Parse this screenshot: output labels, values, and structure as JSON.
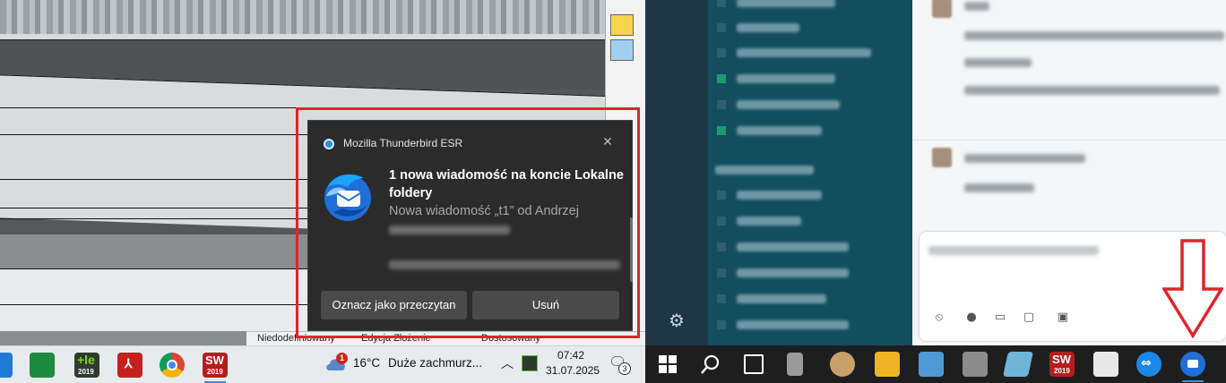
{
  "cad": {
    "status": [
      "Niedodefiniowany",
      "Edycja Złożenie",
      "Dostosowany"
    ]
  },
  "notification": {
    "app_name": "Mozilla Thunderbird ESR",
    "title": "1 nowa wiadomość na koncie Lokalne foldery",
    "body": "Nowa wiadomość „t1” od Andrzej",
    "mark_read_label": "Oznacz jako przeczytan",
    "delete_label": "Usuń",
    "close_icon": "close-icon",
    "highlight_color": "#e0242b"
  },
  "taskbar": {
    "weather": {
      "badge": "1",
      "temperature": "16°C",
      "description": "Duże zachmurz..."
    },
    "clock": {
      "time": "07:42",
      "date": "31.07.2025"
    },
    "notification_count": "3",
    "app_labels": {
      "ie_year": "2019",
      "sw_year": "2019",
      "sw2_year": "2019"
    }
  },
  "colors": {
    "accent": "#3b8ede",
    "arrow": "#e0242b",
    "channels_bg": "#134e5f"
  }
}
